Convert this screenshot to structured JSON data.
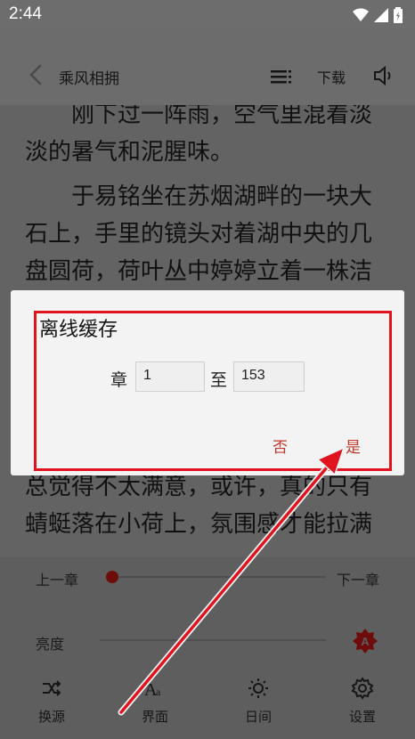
{
  "status": {
    "time": "2:44"
  },
  "header": {
    "title": "乘风相拥",
    "download_label": "下载"
  },
  "reader": {
    "paragraph_1": "刚下过一阵雨，空气里混着淡淡的暑气和泥腥味。",
    "paragraph_2": "于易铭坐在苏烟湖畔的一块大石上，手里的镜头对着湖中央的几盘圆荷，荷叶丛中婷婷立着一株洁满白皮的菡萏",
    "paragraph_3": "总觉得不太满意，或许，真的只有蜻蜓落在小荷上，氛围感才能拉满"
  },
  "dialog": {
    "title": "离线缓存",
    "chapter_label": "章",
    "from_value": "1",
    "to_label": "至",
    "to_value": "153",
    "no_label": "否",
    "yes_label": "是"
  },
  "controls": {
    "prev_label": "上一章",
    "next_label": "下一章",
    "progress": 0.0,
    "brightness_label": "亮度",
    "auto_brightness_letter": "A"
  },
  "bottom_nav": [
    {
      "label": "换源",
      "icon": "shuffle-icon"
    },
    {
      "label": "界面",
      "icon": "font-size-icon"
    },
    {
      "label": "日间",
      "icon": "sun-icon"
    },
    {
      "label": "设置",
      "icon": "gear-icon"
    }
  ],
  "colors": {
    "accent": "#c0392b",
    "annotation": "#e0141e"
  }
}
